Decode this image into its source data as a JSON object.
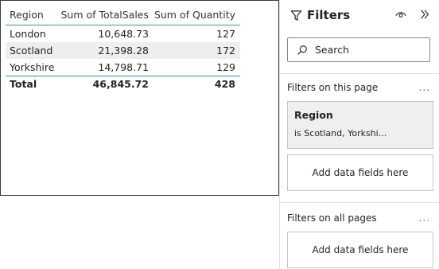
{
  "table": {
    "headers": [
      "Region",
      "Sum of TotalSales",
      "Sum of Quantity"
    ],
    "rows": [
      {
        "region": "London",
        "sales": "10,648.73",
        "qty": "127"
      },
      {
        "region": "Scotland",
        "sales": "21,398.28",
        "qty": "172"
      },
      {
        "region": "Yorkshire",
        "sales": "14,798.71",
        "qty": "129"
      }
    ],
    "total": {
      "label": "Total",
      "sales": "46,845.72",
      "qty": "428"
    },
    "accent_color": "#2a9a9f"
  },
  "filters": {
    "title": "Filters",
    "icons": {
      "title": "filter-icon",
      "visibility": "eye-icon",
      "collapse": "double-chevron-right-icon",
      "search": "search-icon",
      "more": "more-options-icon"
    },
    "search_placeholder": "Search",
    "page_section_label": "Filters on this page",
    "more_label": "...",
    "page_card": {
      "title": "Region",
      "subtitle": "is Scotland, Yorkshi..."
    },
    "page_dropzone_label": "Add data fields here",
    "all_pages_label": "Filters on all pages",
    "all_dropzone_label": "Add data fields here"
  }
}
